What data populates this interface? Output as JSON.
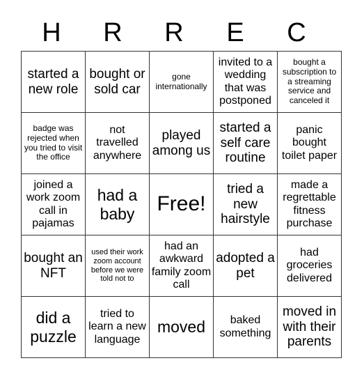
{
  "header": [
    "H",
    "R",
    "R",
    "E",
    "C"
  ],
  "rows": [
    [
      "started a new role",
      "bought or sold car",
      "gone internationally",
      "invited to a wedding that was postponed",
      "bought a subscription to a streaming service and canceled it"
    ],
    [
      "badge was rejected when you tried to visit the office",
      "not travelled anywhere",
      "played among us",
      "started a self care routine",
      "panic bought toilet paper"
    ],
    [
      "joined a work zoom call in pajamas",
      "had a baby",
      "Free!",
      "tried a new hairstyle",
      "made a regrettable fitness purchase"
    ],
    [
      "bought an NFT",
      "used their work zoom account before we were told not to",
      "had an awkward family zoom call",
      "adopted a pet",
      "had groceries delivered"
    ],
    [
      "did a puzzle",
      "tried to learn a new language",
      "moved",
      "baked something",
      "moved in with their parents"
    ]
  ]
}
